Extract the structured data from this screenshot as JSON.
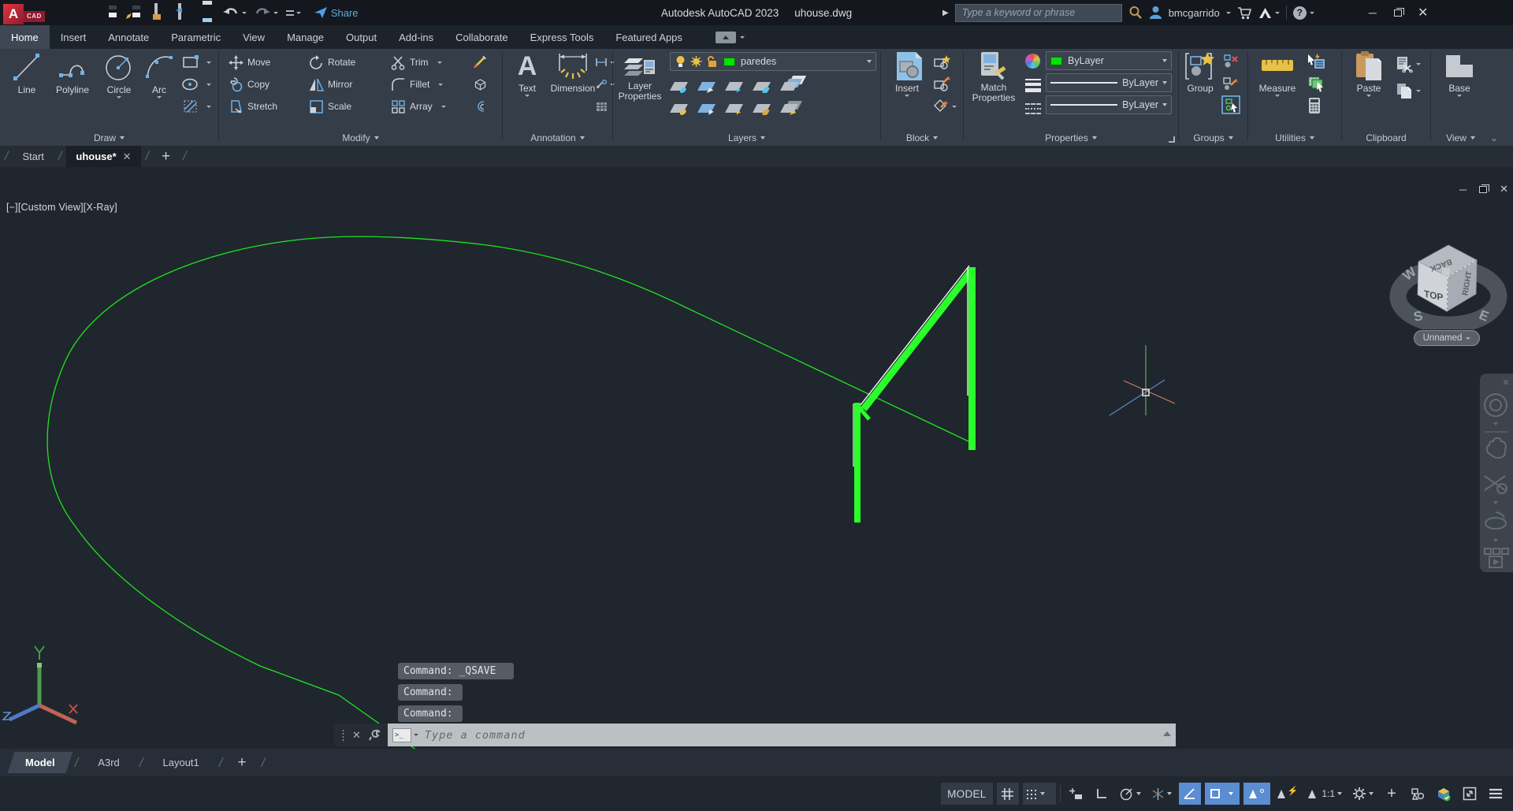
{
  "titlebar": {
    "app_title": "Autodesk AutoCAD 2023",
    "doc_title": "uhouse.dwg",
    "share_label": "Share",
    "search_placeholder": "Type a keyword or phrase",
    "username": "bmcgarrido",
    "help_label": "?"
  },
  "ribbon_tabs": {
    "items": [
      "Home",
      "Insert",
      "Annotate",
      "Parametric",
      "View",
      "Manage",
      "Output",
      "Add-ins",
      "Collaborate",
      "Express Tools",
      "Featured Apps"
    ],
    "active": "Home"
  },
  "ribbon": {
    "draw": {
      "label": "Draw",
      "line": "Line",
      "polyline": "Polyline",
      "circle": "Circle",
      "arc": "Arc"
    },
    "modify": {
      "label": "Modify",
      "move": "Move",
      "rotate": "Rotate",
      "trim": "Trim",
      "copy": "Copy",
      "mirror": "Mirror",
      "fillet": "Fillet",
      "stretch": "Stretch",
      "scale": "Scale",
      "array": "Array"
    },
    "annotation": {
      "label": "Annotation",
      "text": "Text",
      "dimension": "Dimension"
    },
    "layers": {
      "label": "Layers",
      "layer_properties_1": "Layer",
      "layer_properties_2": "Properties",
      "current_layer": "paredes"
    },
    "block": {
      "label": "Block",
      "insert": "Insert"
    },
    "properties": {
      "label": "Properties",
      "match_1": "Match",
      "match_2": "Properties",
      "color_value": "ByLayer",
      "lineweight_value": "ByLayer",
      "linetype_value": "ByLayer"
    },
    "groups": {
      "label": "Groups",
      "group": "Group"
    },
    "utilities": {
      "label": "Utilities",
      "measure": "Measure"
    },
    "clipboard": {
      "label": "Clipboard",
      "paste": "Paste"
    },
    "view": {
      "label": "View",
      "base": "Base"
    }
  },
  "file_tabs": {
    "start": "Start",
    "drawing": "uhouse*"
  },
  "viewport": {
    "controls_label": "[−][Custom View][X-Ray]",
    "viewcube": {
      "top": "TOP",
      "back": "BACK",
      "right": "RIGHT",
      "west": "W",
      "south": "S",
      "east": "E"
    },
    "named_view": "Unnamed"
  },
  "command": {
    "history": [
      "Command: _QSAVE",
      "Command:",
      "Command:"
    ],
    "placeholder": "Type a command"
  },
  "layout_tabs": {
    "model": "Model",
    "a3rd": "A3rd",
    "layout1": "Layout1"
  },
  "statusbar": {
    "model_label": "MODEL",
    "annotation_scale": "1:1"
  },
  "colors": {
    "drawing_green": "#1FE31F",
    "thick_green": "#2BFF2B",
    "layer_swatch": "#00E400",
    "status_highlight": "#5B8DD2"
  }
}
